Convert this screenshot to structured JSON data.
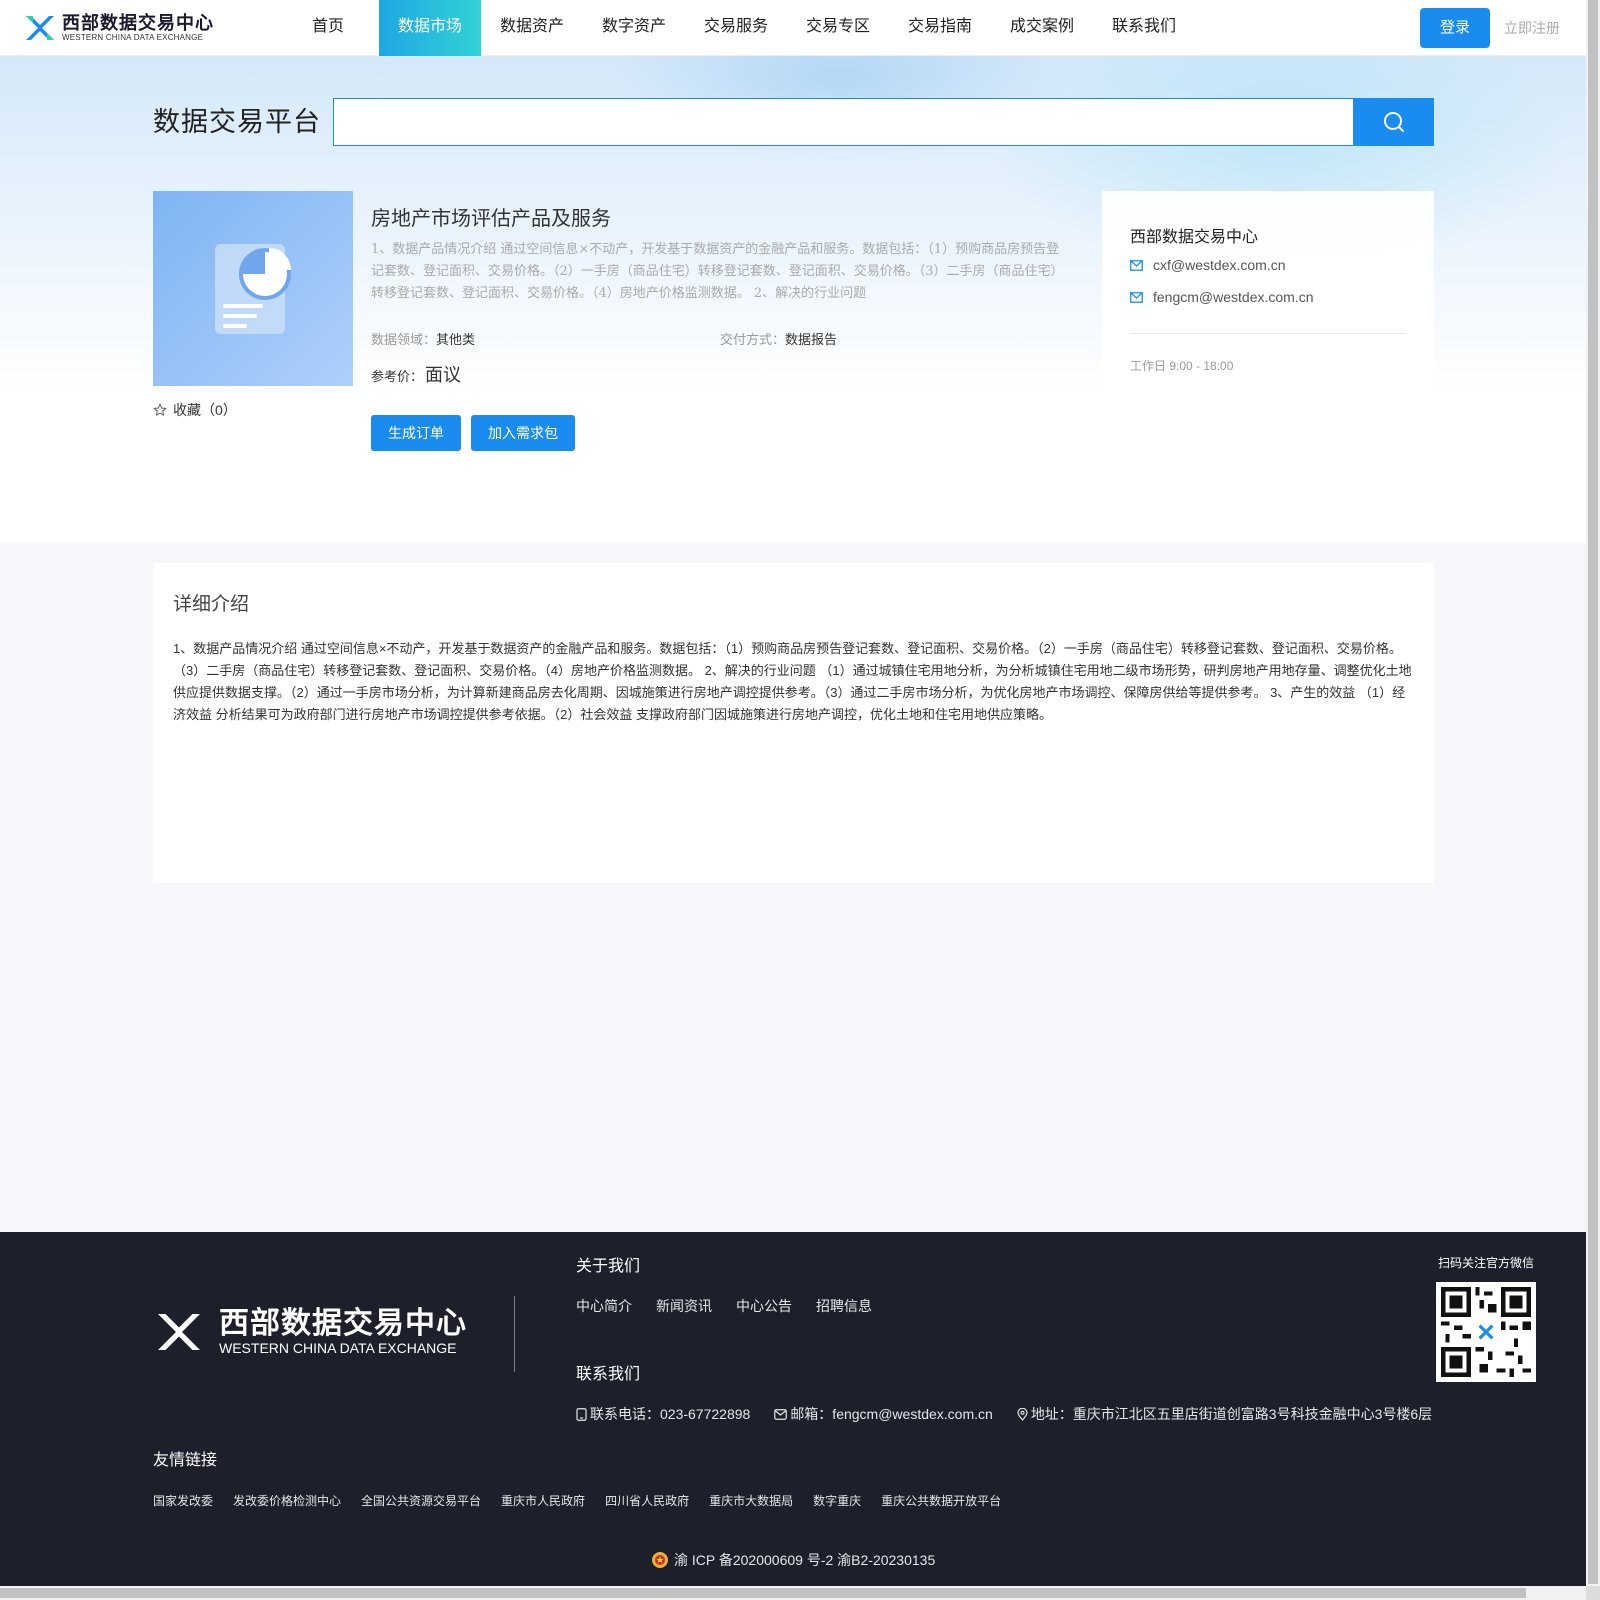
{
  "header": {
    "logo_cn": "西部数据交易中心",
    "logo_en": "WESTERN CHINA DATA EXCHANGE",
    "nav": [
      "首页",
      "数据市场",
      "数据资产",
      "数字资产",
      "交易服务",
      "交易专区",
      "交易指南",
      "成交案例",
      "联系我们"
    ],
    "active_nav": "数据市场",
    "login": "登录",
    "register": "立即注册"
  },
  "search": {
    "platform_title": "数据交易平台",
    "value": "",
    "button_icon": "search-icon"
  },
  "product": {
    "image_icon": "chart-document-icon",
    "favorite_label": "收藏（0）",
    "favorite_icon": "star-icon",
    "title": "房地产市场评估产品及服务",
    "description": "1、数据产品情况介绍 通过空间信息×不动产，开发基于数据资产的金融产品和服务。数据包括：（1）预购商品房预告登记套数、登记面积、交易价格。（2）一手房（商品住宅）转移登记套数、登记面积、交易价格。（3）二手房（商品住宅）转移登记套数、登记面积、交易价格。（4）房地产价格监测数据。 2、解决的行业问题",
    "domain_label": "数据领域：",
    "domain_value": "其他类",
    "delivery_label": "交付方式：",
    "delivery_value": "数据报告",
    "price_label": "参考价：",
    "price_value": "面议",
    "order_button": "生成订单",
    "demand_button": "加入需求包"
  },
  "contact_card": {
    "name": "西部数据交易中心",
    "emails": [
      "cxf@westdex.com.cn",
      "fengcm@westdex.com.cn"
    ],
    "email_icon": "mail-icon",
    "hours": "工作日 9:00 - 18:00"
  },
  "detail": {
    "heading": "详细介绍",
    "body": "1、数据产品情况介绍 通过空间信息×不动产，开发基于数据资产的金融产品和服务。数据包括：（1）预购商品房预告登记套数、登记面积、交易价格。（2）一手房（商品住宅）转移登记套数、登记面积、交易价格。（3）二手房（商品住宅）转移登记套数、登记面积、交易价格。（4）房地产价格监测数据。 2、解决的行业问题 （1）通过城镇住宅用地分析，为分析城镇住宅用地二级市场形势，研判房地产用地存量、调整优化土地供应提供数据支撑。（2）通过一手房市场分析，为计算新建商品房去化周期、因城施策进行房地产调控提供参考。（3）通过二手房市场分析，为优化房地产市场调控、保障房供给等提供参考。 3、产生的效益 （1）经济效益 分析结果可为政府部门进行房地产市场调控提供参考依据。（2）社会效益 支撑政府部门因城施策进行房地产调控，优化土地和住宅用地供应策略。"
  },
  "footer": {
    "logo_cn": "西部数据交易中心",
    "logo_en": "WESTERN CHINA DATA EXCHANGE",
    "about_heading": "关于我们",
    "about_links": [
      "中心简介",
      "新闻资讯",
      "中心公告",
      "招聘信息"
    ],
    "contact_heading": "联系我们",
    "phone": "联系电话：023-67722898",
    "email": "邮箱：fengcm@westdex.com.cn",
    "address": "地址：重庆市江北区五里店街道创富路3号科技金融中心3号楼6层",
    "qr_label": "扫码关注官方微信",
    "links_heading": "友情链接",
    "links": [
      "国家发改委",
      "发改委价格检测中心",
      "全国公共资源交易平台",
      "重庆市人民政府",
      "四川省人民政府",
      "重庆市大数据局",
      "数字重庆",
      "重庆公共数据开放平台"
    ],
    "icp": "渝 ICP 备202000609 号-2 渝B2-20230135"
  }
}
